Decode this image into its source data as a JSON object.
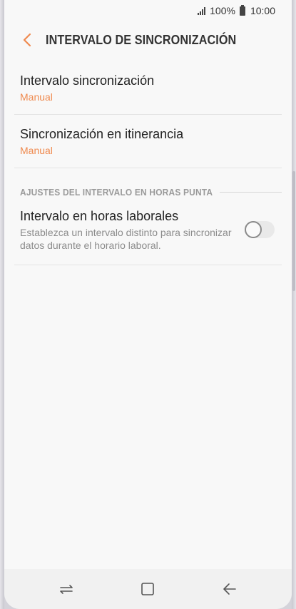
{
  "status_bar": {
    "battery": "100%",
    "time": "10:00"
  },
  "header": {
    "title": "INTERVALO DE SINCRONIZACIÓN",
    "back_icon": "chevron-left-icon"
  },
  "settings": [
    {
      "title": "Intervalo sincronización",
      "value": "Manual"
    },
    {
      "title": "Sincronización en itinerancia",
      "value": "Manual"
    }
  ],
  "section": {
    "label": "AJUSTES DEL INTERVALO EN HORAS PUNTA"
  },
  "toggle_item": {
    "title": "Intervalo en horas laborales",
    "description": "Establezca un intervalo distinto para sincronizar datos durante el horario laboral.",
    "enabled": false
  },
  "colors": {
    "accent": "#ef8a4f",
    "background": "#f8f8f8"
  },
  "nav_bar": {
    "icons": [
      "recent-apps-icon",
      "home-icon",
      "back-icon"
    ]
  }
}
